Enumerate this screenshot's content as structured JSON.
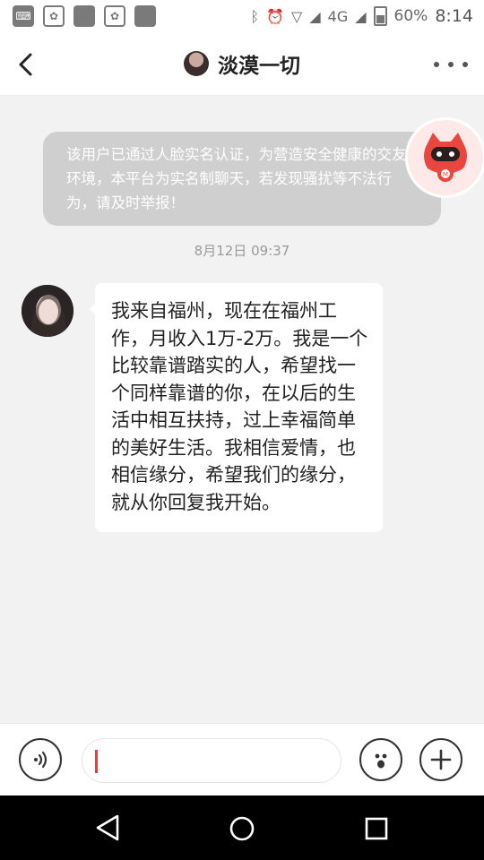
{
  "status_bar": {
    "battery": "60%",
    "time": "8:14",
    "network": "4G",
    "signal_sub": "1"
  },
  "header": {
    "title": "淡漠一切"
  },
  "chat": {
    "notice": "该用户已通过人脸实名认证，为营造安全健康的交友环境，本平台为实名制聊天，若发现骚扰等不法行为，请及时举报！",
    "timestamp": "8月12日 09:37",
    "messages": [
      {
        "side": "left",
        "text": "我来自福州，现在在福州工作，月收入1万-2万。我是一个比较靠谱踏实的人，希望找一个同样靠谱的你，在以后的生活中相互扶持，过上幸福简单的美好生活。我相信爱情，也相信缘分，希望我们的缘分，就从你回复我开始。"
      }
    ]
  },
  "input": {
    "placeholder": ""
  },
  "colors": {
    "notice_bg": "#cfcfcf",
    "caret": "#e0413a",
    "mascot": "#e8463f"
  }
}
